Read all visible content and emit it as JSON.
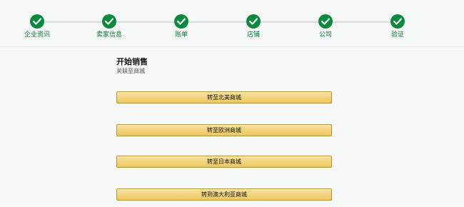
{
  "stepper": {
    "steps": [
      {
        "label": "企业资讯",
        "status": "completed"
      },
      {
        "label": "卖家信息",
        "status": "completed"
      },
      {
        "label": "账单",
        "status": "completed"
      },
      {
        "label": "店铺",
        "status": "completed"
      },
      {
        "label": "公司",
        "status": "completed"
      },
      {
        "label": "验证",
        "status": "completed"
      }
    ],
    "completed_color": "#0a8a3c"
  },
  "main": {
    "title": "开始销售",
    "subtitle": "关联至商城",
    "buttons": [
      {
        "label": "转至北美商城"
      },
      {
        "label": "转至欧洲商城"
      },
      {
        "label": "转至日本商城"
      },
      {
        "label": "转到澳大利亚商城"
      }
    ],
    "button_color": "#efc75c"
  }
}
